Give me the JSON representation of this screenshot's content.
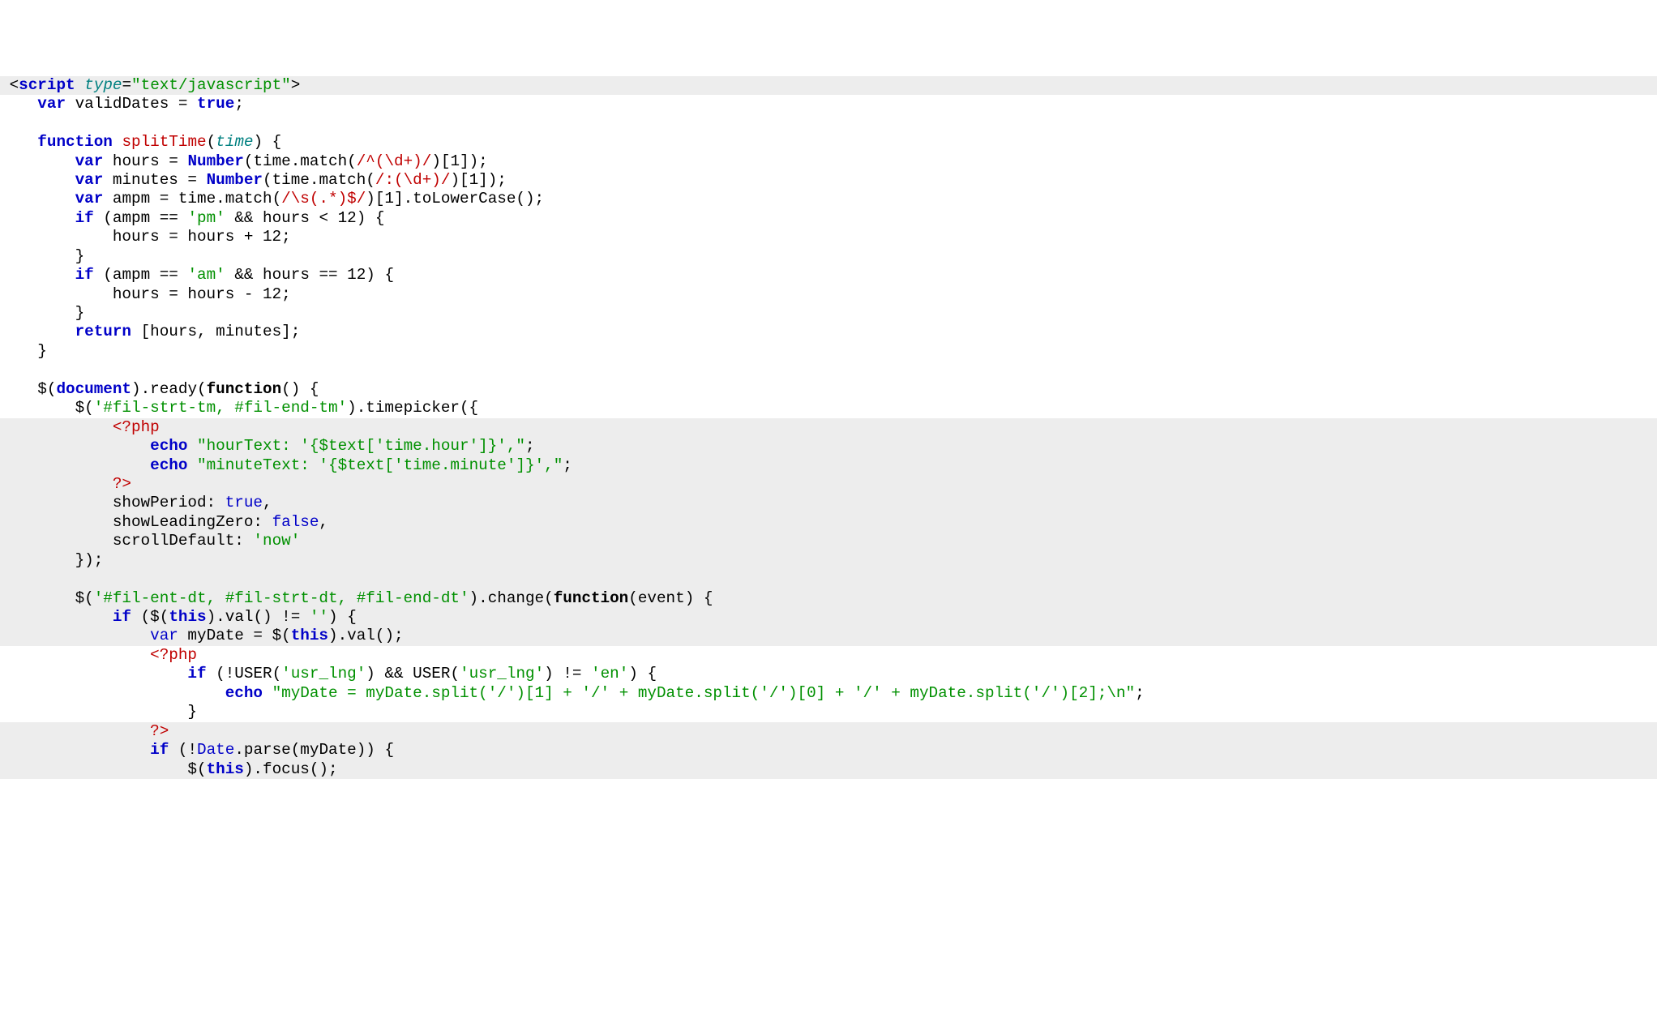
{
  "code": {
    "lines": [
      {
        "bg": "bg-gray",
        "segs": [
          {
            "cls": "",
            "t": " <"
          },
          {
            "cls": "blue-bold",
            "t": "script"
          },
          {
            "cls": "",
            "t": " "
          },
          {
            "cls": "teal",
            "t": "type"
          },
          {
            "cls": "",
            "t": "="
          },
          {
            "cls": "green",
            "t": "\"text/javascript\""
          },
          {
            "cls": "",
            "t": ">"
          }
        ]
      },
      {
        "bg": "bg-white",
        "segs": [
          {
            "cls": "",
            "t": "    "
          },
          {
            "cls": "blue-bold",
            "t": "var"
          },
          {
            "cls": "",
            "t": " validDates = "
          },
          {
            "cls": "blue-bold",
            "t": "true"
          },
          {
            "cls": "",
            "t": ";"
          }
        ]
      },
      {
        "bg": "bg-white",
        "segs": [
          {
            "cls": "",
            "t": " "
          }
        ]
      },
      {
        "bg": "bg-white",
        "segs": [
          {
            "cls": "",
            "t": "    "
          },
          {
            "cls": "blue-bold",
            "t": "function"
          },
          {
            "cls": "",
            "t": " "
          },
          {
            "cls": "red",
            "t": "splitTime"
          },
          {
            "cls": "",
            "t": "("
          },
          {
            "cls": "teal",
            "t": "time"
          },
          {
            "cls": "",
            "t": ") {"
          }
        ]
      },
      {
        "bg": "bg-white",
        "segs": [
          {
            "cls": "",
            "t": "        "
          },
          {
            "cls": "blue-bold",
            "t": "var"
          },
          {
            "cls": "",
            "t": " hours = "
          },
          {
            "cls": "blue-bold",
            "t": "Number"
          },
          {
            "cls": "",
            "t": "(time.match("
          },
          {
            "cls": "red",
            "t": "/^(\\d+)/"
          },
          {
            "cls": "",
            "t": ")[1]);"
          }
        ]
      },
      {
        "bg": "bg-white",
        "segs": [
          {
            "cls": "",
            "t": "        "
          },
          {
            "cls": "blue-bold",
            "t": "var"
          },
          {
            "cls": "",
            "t": " minutes = "
          },
          {
            "cls": "blue-bold",
            "t": "Number"
          },
          {
            "cls": "",
            "t": "(time.match("
          },
          {
            "cls": "red",
            "t": "/:(\\d+)/"
          },
          {
            "cls": "",
            "t": ")[1]);"
          }
        ]
      },
      {
        "bg": "bg-white",
        "segs": [
          {
            "cls": "",
            "t": "        "
          },
          {
            "cls": "blue-bold",
            "t": "var"
          },
          {
            "cls": "",
            "t": " ampm = time.match("
          },
          {
            "cls": "red",
            "t": "/\\s(.*)$/"
          },
          {
            "cls": "",
            "t": ")[1].toLowerCase();"
          }
        ]
      },
      {
        "bg": "bg-white",
        "segs": [
          {
            "cls": "",
            "t": "        "
          },
          {
            "cls": "blue-bold",
            "t": "if"
          },
          {
            "cls": "",
            "t": " (ampm == "
          },
          {
            "cls": "green",
            "t": "'pm'"
          },
          {
            "cls": "",
            "t": " && hours < 12) {"
          }
        ]
      },
      {
        "bg": "bg-white",
        "segs": [
          {
            "cls": "",
            "t": "            hours = hours + 12;"
          }
        ]
      },
      {
        "bg": "bg-white",
        "segs": [
          {
            "cls": "",
            "t": "        }"
          }
        ]
      },
      {
        "bg": "bg-white",
        "segs": [
          {
            "cls": "",
            "t": "        "
          },
          {
            "cls": "blue-bold",
            "t": "if"
          },
          {
            "cls": "",
            "t": " (ampm == "
          },
          {
            "cls": "green",
            "t": "'am'"
          },
          {
            "cls": "",
            "t": " && hours == 12) {"
          }
        ]
      },
      {
        "bg": "bg-white",
        "segs": [
          {
            "cls": "",
            "t": "            hours = hours - 12;"
          }
        ]
      },
      {
        "bg": "bg-white",
        "segs": [
          {
            "cls": "",
            "t": "        }"
          }
        ]
      },
      {
        "bg": "bg-white",
        "segs": [
          {
            "cls": "",
            "t": "        "
          },
          {
            "cls": "blue-bold",
            "t": "return"
          },
          {
            "cls": "",
            "t": " [hours, minutes];"
          }
        ]
      },
      {
        "bg": "bg-white",
        "segs": [
          {
            "cls": "",
            "t": "    }"
          }
        ]
      },
      {
        "bg": "bg-white",
        "segs": [
          {
            "cls": "",
            "t": " "
          }
        ]
      },
      {
        "bg": "bg-white",
        "segs": [
          {
            "cls": "",
            "t": "    $("
          },
          {
            "cls": "blue-bold",
            "t": "document"
          },
          {
            "cls": "",
            "t": ").ready("
          },
          {
            "cls": "black-bold",
            "t": "function"
          },
          {
            "cls": "",
            "t": "() {"
          }
        ]
      },
      {
        "bg": "bg-white",
        "segs": [
          {
            "cls": "",
            "t": "        $("
          },
          {
            "cls": "green",
            "t": "'#fil-strt-tm, #fil-end-tm'"
          },
          {
            "cls": "",
            "t": ").timepicker({"
          }
        ]
      },
      {
        "bg": "bg-gray",
        "segs": [
          {
            "cls": "",
            "t": "            "
          },
          {
            "cls": "red",
            "t": "<?php"
          }
        ]
      },
      {
        "bg": "bg-gray",
        "segs": [
          {
            "cls": "",
            "t": "                "
          },
          {
            "cls": "blue-bold",
            "t": "echo"
          },
          {
            "cls": "",
            "t": " "
          },
          {
            "cls": "green",
            "t": "\"hourText: '{$text['time.hour']}',\""
          },
          {
            "cls": "",
            "t": ";"
          }
        ]
      },
      {
        "bg": "bg-gray",
        "segs": [
          {
            "cls": "",
            "t": "                "
          },
          {
            "cls": "blue-bold",
            "t": "echo"
          },
          {
            "cls": "",
            "t": " "
          },
          {
            "cls": "green",
            "t": "\"minuteText: '{$text['time.minute']}',\""
          },
          {
            "cls": "",
            "t": ";"
          }
        ]
      },
      {
        "bg": "bg-gray",
        "segs": [
          {
            "cls": "",
            "t": "            "
          },
          {
            "cls": "red",
            "t": "?>"
          }
        ]
      },
      {
        "bg": "bg-gray",
        "segs": [
          {
            "cls": "",
            "t": "            showPeriod: "
          },
          {
            "cls": "blue",
            "t": "true"
          },
          {
            "cls": "",
            "t": ","
          }
        ]
      },
      {
        "bg": "bg-gray",
        "segs": [
          {
            "cls": "",
            "t": "            showLeadingZero: "
          },
          {
            "cls": "blue",
            "t": "false"
          },
          {
            "cls": "",
            "t": ","
          }
        ]
      },
      {
        "bg": "bg-gray",
        "segs": [
          {
            "cls": "",
            "t": "            scrollDefault: "
          },
          {
            "cls": "green",
            "t": "'now'"
          }
        ]
      },
      {
        "bg": "bg-gray",
        "segs": [
          {
            "cls": "",
            "t": "        });"
          }
        ]
      },
      {
        "bg": "bg-gray",
        "segs": [
          {
            "cls": "",
            "t": " "
          }
        ]
      },
      {
        "bg": "bg-gray",
        "segs": [
          {
            "cls": "",
            "t": "        $("
          },
          {
            "cls": "green",
            "t": "'#fil-ent-dt, #fil-strt-dt, #fil-end-dt'"
          },
          {
            "cls": "",
            "t": ").change("
          },
          {
            "cls": "black-bold",
            "t": "function"
          },
          {
            "cls": "",
            "t": "(event) {"
          }
        ]
      },
      {
        "bg": "bg-gray",
        "segs": [
          {
            "cls": "",
            "t": "            "
          },
          {
            "cls": "blue-bold",
            "t": "if"
          },
          {
            "cls": "",
            "t": " ($("
          },
          {
            "cls": "blue-bold",
            "t": "this"
          },
          {
            "cls": "",
            "t": ").val() != "
          },
          {
            "cls": "green",
            "t": "''"
          },
          {
            "cls": "",
            "t": ") {"
          }
        ]
      },
      {
        "bg": "bg-gray",
        "segs": [
          {
            "cls": "",
            "t": "                "
          },
          {
            "cls": "blue",
            "t": "var"
          },
          {
            "cls": "",
            "t": " myDate = $("
          },
          {
            "cls": "blue-bold",
            "t": "this"
          },
          {
            "cls": "",
            "t": ").val();"
          }
        ]
      },
      {
        "bg": "bg-white",
        "segs": [
          {
            "cls": "",
            "t": "                "
          },
          {
            "cls": "red",
            "t": "<?php"
          }
        ]
      },
      {
        "bg": "bg-white",
        "segs": [
          {
            "cls": "",
            "t": "                    "
          },
          {
            "cls": "blue-bold",
            "t": "if"
          },
          {
            "cls": "",
            "t": " (!USER("
          },
          {
            "cls": "green",
            "t": "'usr_lng'"
          },
          {
            "cls": "",
            "t": ") && USER("
          },
          {
            "cls": "green",
            "t": "'usr_lng'"
          },
          {
            "cls": "",
            "t": ") != "
          },
          {
            "cls": "green",
            "t": "'en'"
          },
          {
            "cls": "",
            "t": ") {"
          }
        ]
      },
      {
        "bg": "bg-white",
        "segs": [
          {
            "cls": "",
            "t": "                        "
          },
          {
            "cls": "blue-bold",
            "t": "echo"
          },
          {
            "cls": "",
            "t": " "
          },
          {
            "cls": "green",
            "t": "\"myDate = myDate.split('/')[1] + '/' + myDate.split('/')[0] + '/' + myDate.split('/')[2];\\n\""
          },
          {
            "cls": "",
            "t": ";"
          }
        ]
      },
      {
        "bg": "bg-white",
        "segs": [
          {
            "cls": "",
            "t": "                    }"
          }
        ]
      },
      {
        "bg": "bg-gray",
        "segs": [
          {
            "cls": "",
            "t": "                "
          },
          {
            "cls": "red",
            "t": "?>"
          }
        ]
      },
      {
        "bg": "bg-gray",
        "segs": [
          {
            "cls": "",
            "t": "                "
          },
          {
            "cls": "blue-bold",
            "t": "if"
          },
          {
            "cls": "",
            "t": " (!"
          },
          {
            "cls": "blue",
            "t": "Date"
          },
          {
            "cls": "",
            "t": ".parse(myDate)) {"
          }
        ]
      },
      {
        "bg": "bg-gray",
        "segs": [
          {
            "cls": "",
            "t": "                    $("
          },
          {
            "cls": "blue-bold",
            "t": "this"
          },
          {
            "cls": "",
            "t": ").focus();"
          }
        ]
      }
    ]
  }
}
